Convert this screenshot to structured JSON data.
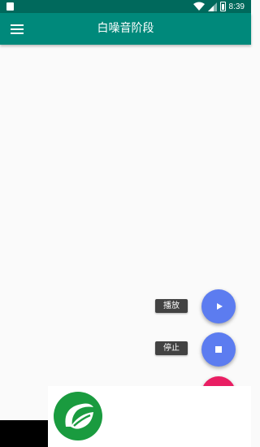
{
  "status_bar": {
    "time": "8:39",
    "background": "#00695c"
  },
  "toolbar": {
    "title": "白噪音阶段",
    "background": "#00897b",
    "menu_icon": "menu-icon"
  },
  "fab_menu": {
    "play": {
      "label": "播放",
      "icon": "play-icon",
      "color": "#5c7cf0"
    },
    "stop": {
      "label": "停止",
      "icon": "stop-icon",
      "color": "#5c7cf0"
    },
    "main": {
      "color": "#e91e63"
    }
  },
  "logo": {
    "icon": "leaf-logo-icon",
    "color": "#1a9b3f"
  }
}
